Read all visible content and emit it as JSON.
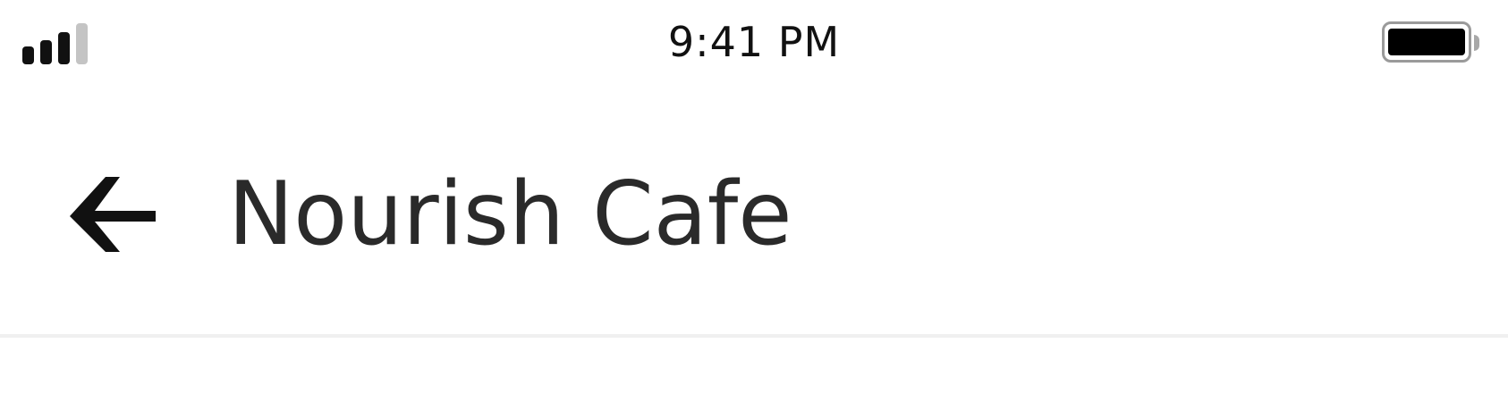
{
  "status_bar": {
    "time": "9:41 PM",
    "signal_icon": "cellular-signal-icon",
    "signal_bars_filled": 3,
    "signal_bars_total": 4,
    "battery_icon": "battery-icon",
    "battery_level": 1.0
  },
  "header": {
    "back_icon": "arrow-left-icon",
    "title": "Nourish Cafe"
  },
  "colors": {
    "background": "#ffffff",
    "text": "#2a2a2a",
    "divider": "#f0f0f0",
    "inactive_signal": "#c4c4c4"
  }
}
